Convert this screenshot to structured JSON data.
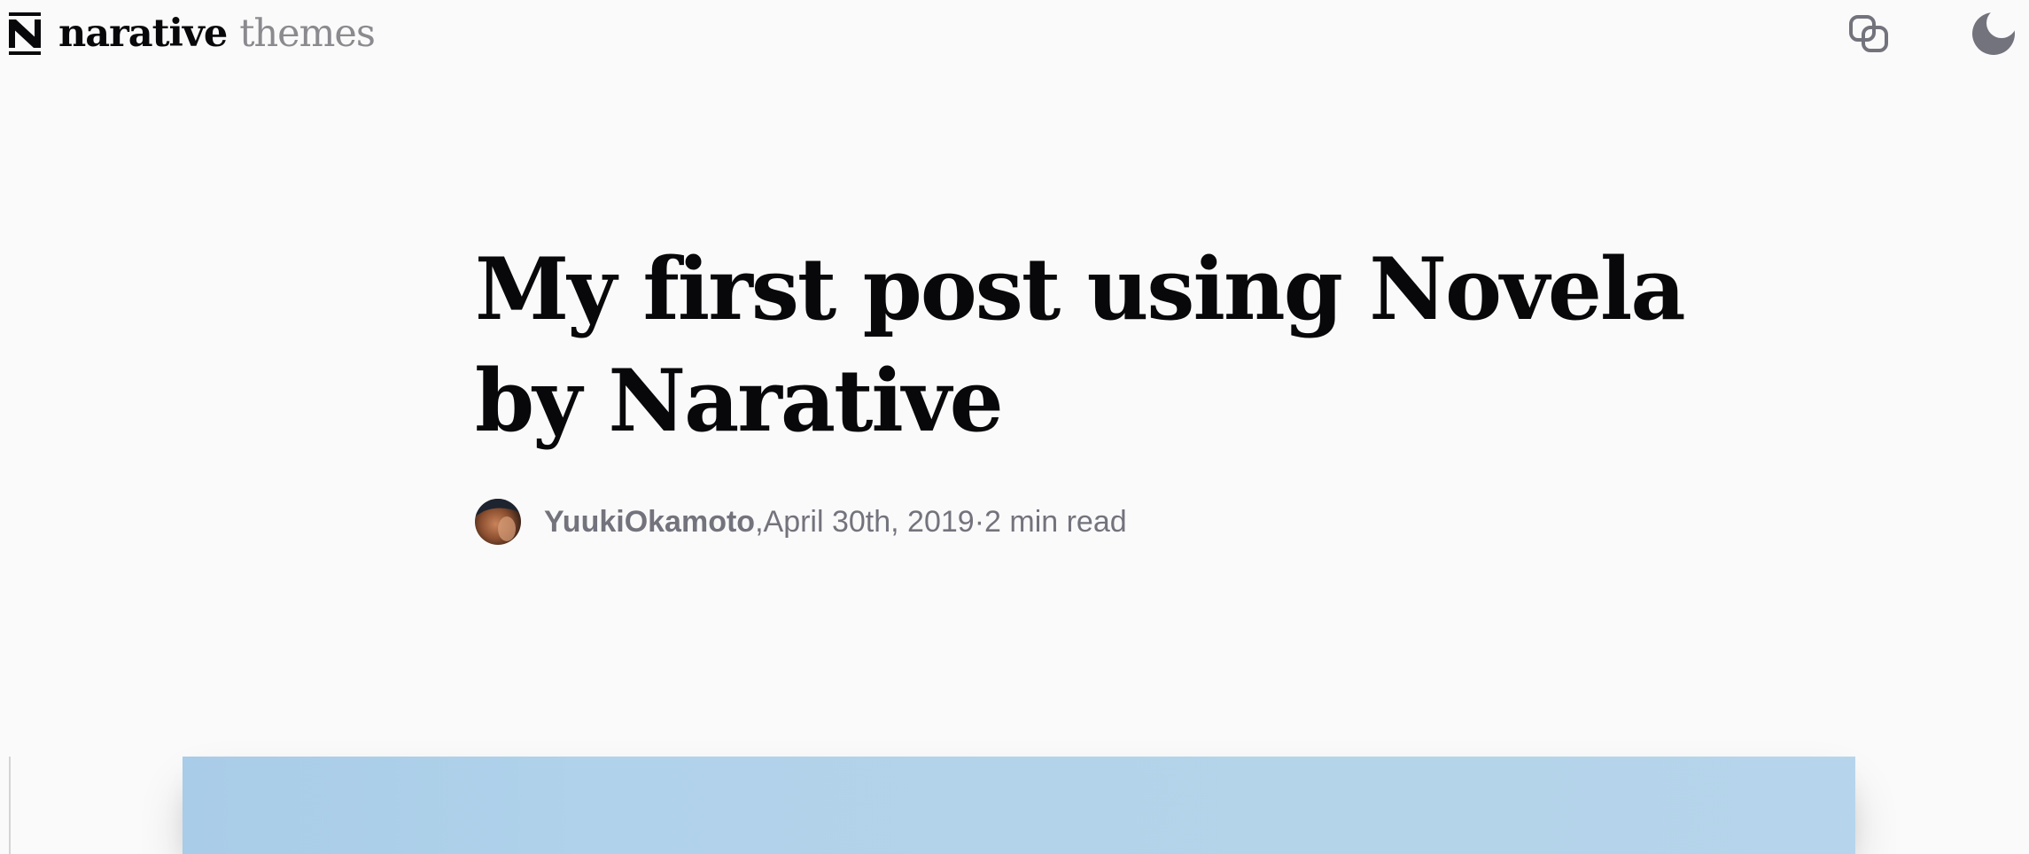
{
  "header": {
    "logo_word": "narative",
    "logo_sub": "themes",
    "copy_button_icon": "copy-link-icon",
    "theme_button_icon": "moon-icon"
  },
  "post": {
    "title": "My first post using Novela by Narative",
    "author": "YuukiOkamoto",
    "date": "April 30th, 2019",
    "separator": ", ",
    "dot": " · ",
    "read_time": "2 min read"
  },
  "colors": {
    "background": "#fafafa",
    "title": "#08080b",
    "meta_text": "#73737d",
    "hero_image": "#b0d2ea"
  }
}
